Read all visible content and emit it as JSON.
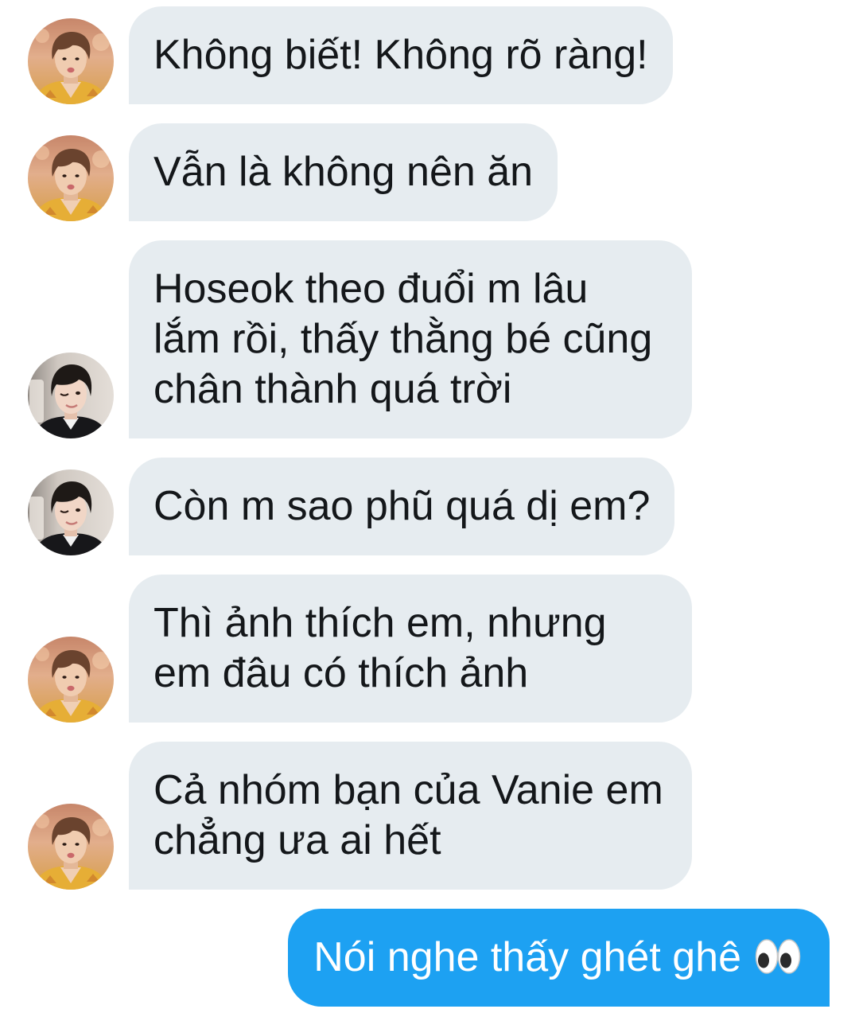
{
  "messages": [
    {
      "direction": "received",
      "avatar_icon": "avatar-orange-outfit",
      "lines": [
        "Không biết! Không rõ ràng!"
      ]
    },
    {
      "direction": "received",
      "avatar_icon": "avatar-orange-outfit",
      "lines": [
        "Vẫn là không nên ăn"
      ]
    },
    {
      "direction": "received",
      "avatar_icon": "avatar-dark-jacket",
      "lines": [
        "Hoseok theo đuổi m lâu",
        "lắm rồi, thấy thằng bé cũng",
        "chân thành quá trời"
      ]
    },
    {
      "direction": "received",
      "avatar_icon": "avatar-dark-jacket",
      "lines": [
        "Còn m sao phũ quá dị em?"
      ]
    },
    {
      "direction": "received",
      "avatar_icon": "avatar-orange-outfit",
      "lines": [
        "Thì ảnh thích em, nhưng",
        "em đâu có thích ảnh"
      ]
    },
    {
      "direction": "received",
      "avatar_icon": "avatar-orange-outfit",
      "lines": [
        "Cả nhóm bạn của Vanie em",
        "chẳng ưa ai hết"
      ]
    },
    {
      "direction": "sent",
      "text": "Nói nghe thấy ghét ghê",
      "emoji_icon": "eyes-emoji"
    }
  ],
  "colors": {
    "background": "#FFFFFF",
    "received_bubble": "#E6ECF0",
    "received_text": "#14171A",
    "sent_bubble": "#1DA1F2",
    "sent_text": "#FFFFFF"
  }
}
